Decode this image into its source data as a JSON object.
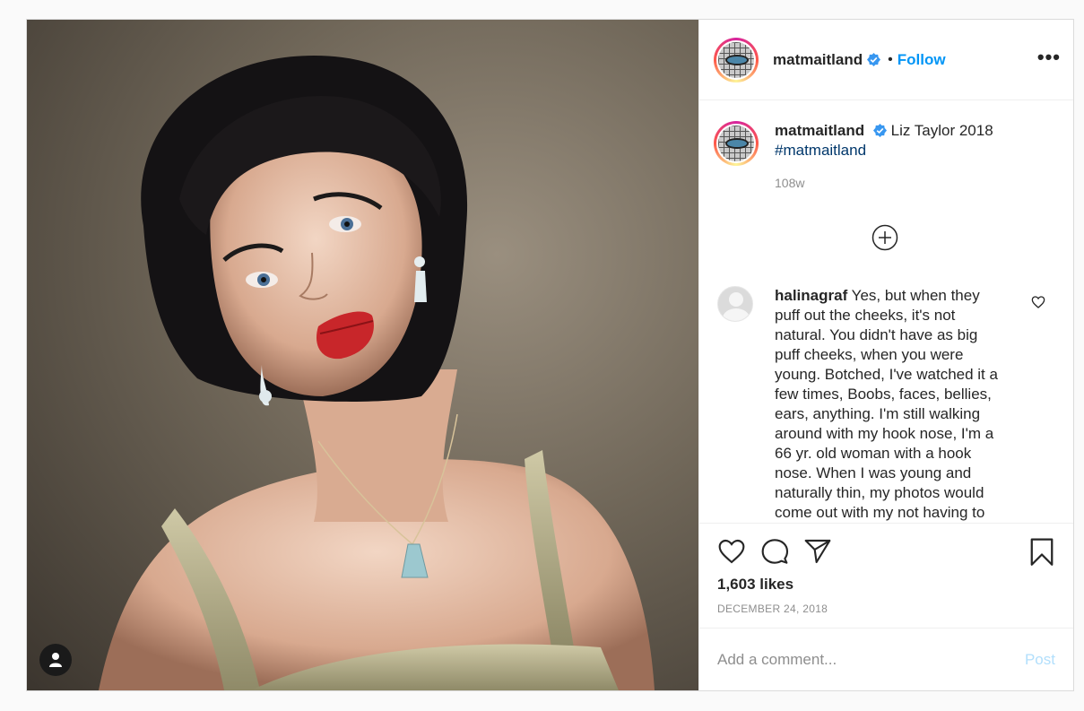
{
  "post": {
    "author": "matmaitland",
    "follow_label": "Follow",
    "dot": "•",
    "more_label": "•••",
    "caption": {
      "text": "Liz Taylor 2018",
      "hashtag": "#matmaitland",
      "time": "108w"
    },
    "comments": [
      {
        "user": "halinagraf",
        "text": "Yes, but when they puff out the cheeks, it's not natural. You didn't have as big puff cheeks, when you were young. Botched, I've watched it a few times, Boobs, faces, bellies, ears, anything. I'm still walking around with my hook nose, I'm a 66 yr. old woman with a hook nose. When I was young and naturally thin, my photos would come out with my not having to"
      }
    ],
    "likes": "1,603 likes",
    "date": "DECEMBER 24, 2018",
    "add_comment": {
      "placeholder": "Add a comment...",
      "post_label": "Post"
    }
  },
  "icons": {
    "verified": "verified-badge-icon",
    "like": "heart-icon",
    "comment": "comment-icon",
    "share": "paper-plane-icon",
    "save": "bookmark-icon",
    "load_more": "plus-circle-icon",
    "tag": "user-icon"
  },
  "colors": {
    "accent": "#0095f6",
    "verified": "#3897f0",
    "post_disabled": "#b2dffc"
  }
}
